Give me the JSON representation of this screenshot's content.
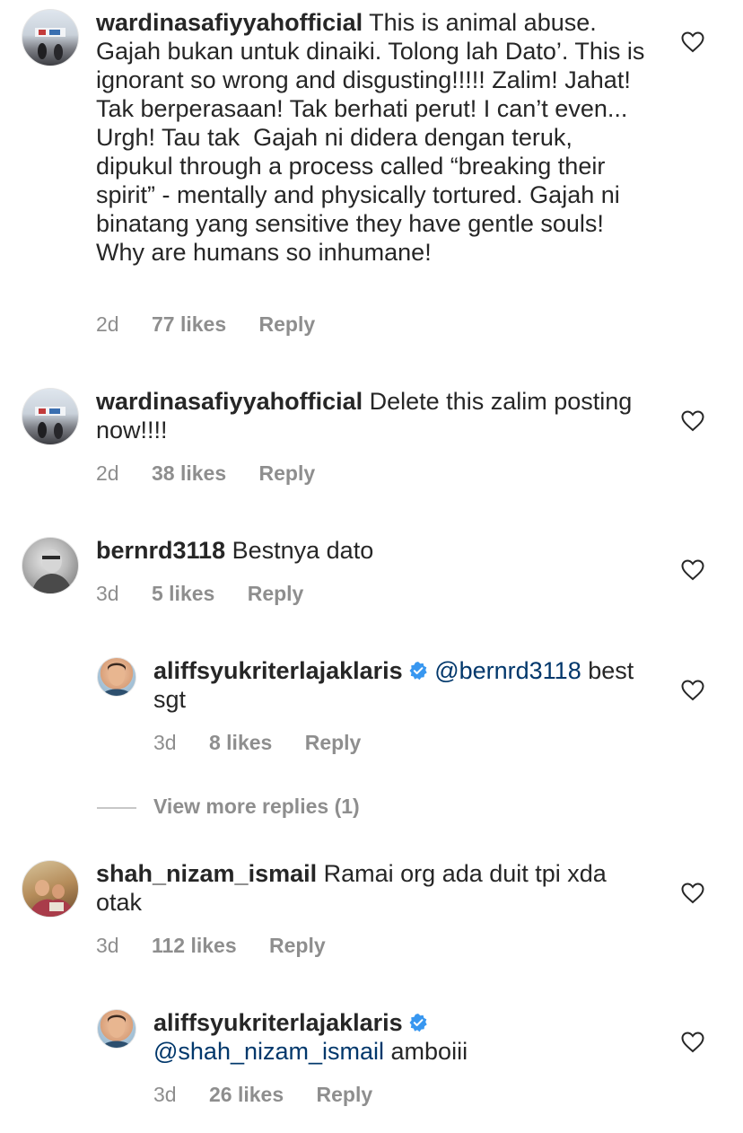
{
  "comments": [
    {
      "username": "wardinasafiyyahofficial",
      "text": "This is animal abuse. Gajah bukan untuk dinaiki. Tolong lah Dato’. This is ignorant so wrong and disgusting!!!!! Zalim! Jahat! Tak berperasaan! Tak berhati perut! I can’t even... Urgh! Tau tak  Gajah ni didera dengan teruk, dipukul through a process called “breaking their spirit” - mentally and physically tortured. Gajah ni binatang yang sensitive they have gentle souls! Why are humans so inhumane!",
      "time": "2d",
      "likes": "77 likes",
      "reply": "Reply"
    },
    {
      "username": "wardinasafiyyahofficial",
      "text": "Delete this zalim posting now!!!!",
      "time": "2d",
      "likes": "38 likes",
      "reply": "Reply"
    },
    {
      "username": "bernrd3118",
      "text": "Bestnya dato",
      "time": "3d",
      "likes": "5 likes",
      "reply": "Reply"
    },
    {
      "username": "aliffsyukriterlajaklaris",
      "mention": "@bernrd3118",
      "text": "best sgt",
      "time": "3d",
      "likes": "8 likes",
      "reply": "Reply"
    },
    {
      "username": "shah_nizam_ismail",
      "text": "Ramai org ada duit tpi xda otak",
      "time": "3d",
      "likes": "112 likes",
      "reply": "Reply"
    },
    {
      "username": "aliffsyukriterlajaklaris",
      "mention": "@shah_nizam_ismail",
      "text": "amboiii",
      "time": "3d",
      "likes": "26 likes",
      "reply": "Reply"
    }
  ],
  "view_more_replies": "View more replies (1)",
  "colors": {
    "text": "#262626",
    "meta": "#8e8e8e",
    "mention": "#00376b",
    "verified": "#3897f0"
  },
  "icons": {
    "like": "heart-outline-icon",
    "verified": "verified-badge-icon"
  }
}
